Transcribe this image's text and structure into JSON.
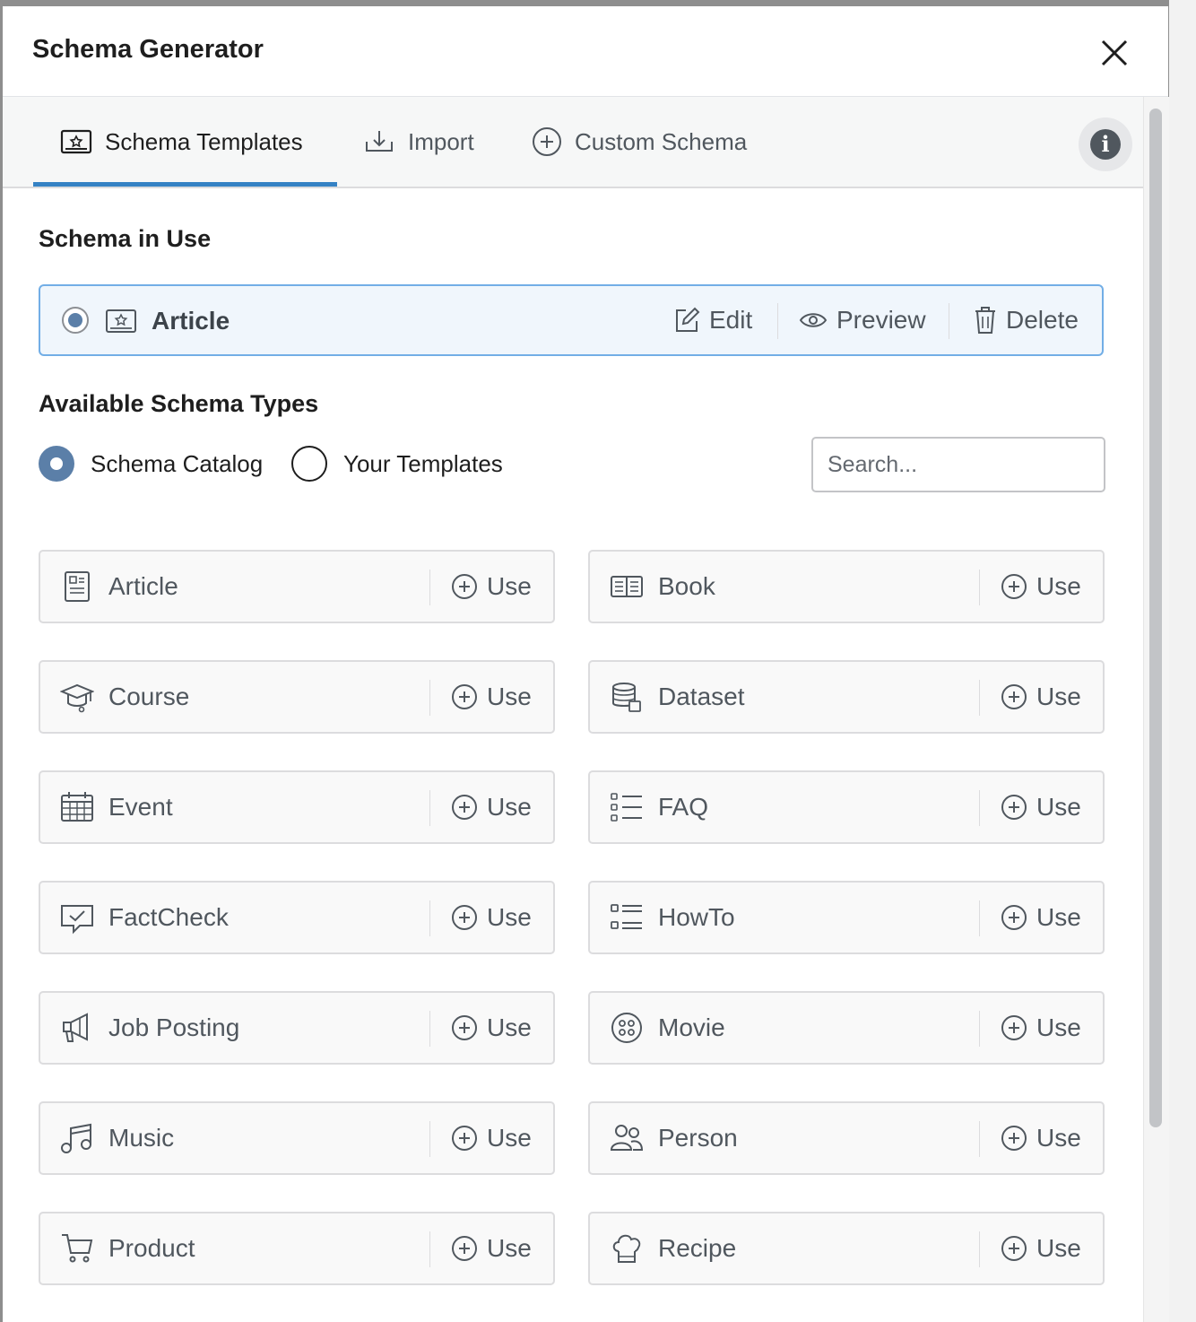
{
  "modal": {
    "title": "Schema Generator"
  },
  "tabs": [
    {
      "label": "Schema Templates",
      "icon": "schema-templates-icon",
      "active": true
    },
    {
      "label": "Import",
      "icon": "import-icon",
      "active": false
    },
    {
      "label": "Custom Schema",
      "icon": "plus-circle-icon",
      "active": false
    }
  ],
  "schema_in_use": {
    "heading": "Schema in Use",
    "item": {
      "label": "Article",
      "selected": true,
      "actions": {
        "edit": "Edit",
        "preview": "Preview",
        "delete": "Delete"
      }
    }
  },
  "available": {
    "heading": "Available Schema Types",
    "options": [
      {
        "label": "Schema Catalog",
        "selected": true
      },
      {
        "label": "Your Templates",
        "selected": false
      }
    ],
    "search": {
      "placeholder": "Search...",
      "value": ""
    },
    "use_label": "Use",
    "types": [
      {
        "label": "Article",
        "icon": "article-icon"
      },
      {
        "label": "Book",
        "icon": "book-icon"
      },
      {
        "label": "Course",
        "icon": "course-icon"
      },
      {
        "label": "Dataset",
        "icon": "dataset-icon"
      },
      {
        "label": "Event",
        "icon": "calendar-icon"
      },
      {
        "label": "FAQ",
        "icon": "faq-list-icon"
      },
      {
        "label": "FactCheck",
        "icon": "factcheck-icon"
      },
      {
        "label": "HowTo",
        "icon": "howto-list-icon"
      },
      {
        "label": "Job Posting",
        "icon": "megaphone-icon"
      },
      {
        "label": "Movie",
        "icon": "film-reel-icon"
      },
      {
        "label": "Music",
        "icon": "music-note-icon"
      },
      {
        "label": "Person",
        "icon": "people-icon"
      },
      {
        "label": "Product",
        "icon": "cart-icon"
      },
      {
        "label": "Recipe",
        "icon": "chef-hat-icon"
      }
    ]
  },
  "colors": {
    "accent": "#3582c4",
    "radio_selected": "#5b7fa8",
    "in_use_border": "#72aee6",
    "in_use_background": "#f0f6fc"
  }
}
